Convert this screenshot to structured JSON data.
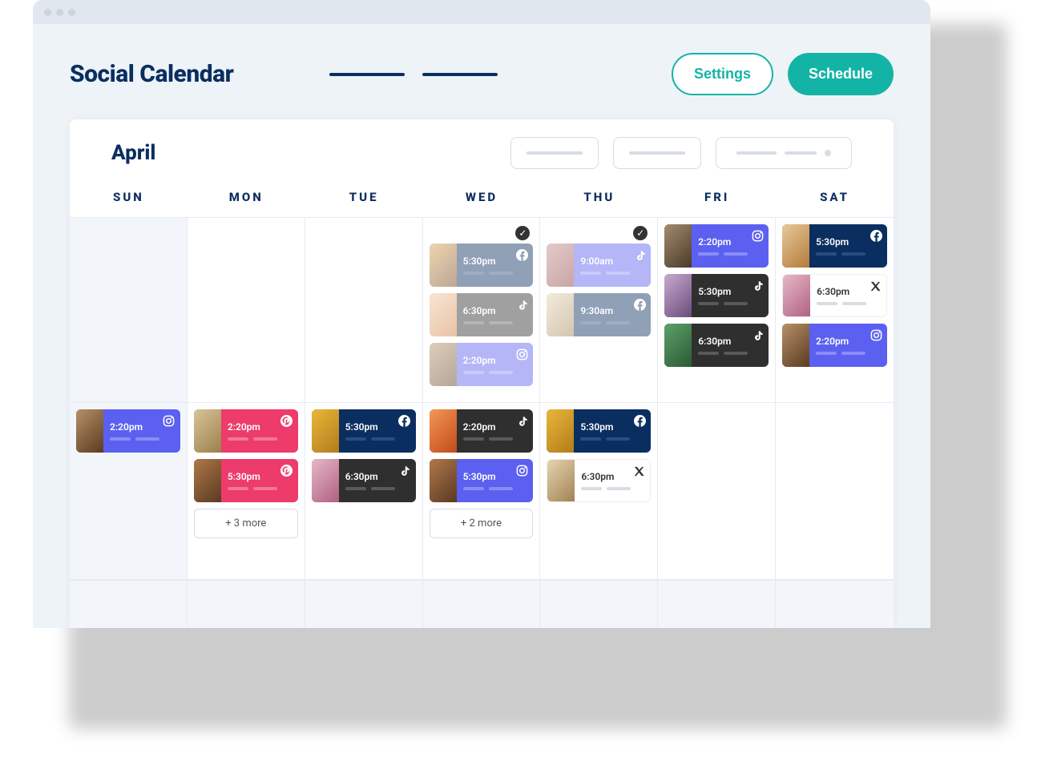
{
  "header": {
    "title": "Social Calendar",
    "settings": "Settings",
    "schedule": "Schedule"
  },
  "month": "April",
  "days": [
    "SUN",
    "MON",
    "TUE",
    "WED",
    "THU",
    "FRI",
    "SAT"
  ],
  "rows": [
    {
      "period": "past",
      "cells": [
        {
          "out": true,
          "posts": []
        },
        {
          "out": false,
          "posts": []
        },
        {
          "out": false,
          "posts": []
        },
        {
          "out": false,
          "checked": true,
          "posts": [
            {
              "time": "5:30pm",
              "color": "c-navy",
              "icon": "facebook",
              "thumb": "t1",
              "faded": true
            },
            {
              "time": "6:30pm",
              "color": "c-dark",
              "icon": "tiktok",
              "thumb": "t5",
              "faded": true
            },
            {
              "time": "2:20pm",
              "color": "c-indigo",
              "icon": "instagram",
              "thumb": "t4",
              "faded": true
            }
          ]
        },
        {
          "out": false,
          "checked": true,
          "posts": [
            {
              "time": "9:00am",
              "color": "c-indigo",
              "icon": "tiktok",
              "thumb": "t2",
              "faded": true
            },
            {
              "time": "9:30am",
              "color": "c-navy",
              "icon": "facebook",
              "thumb": "t14",
              "faded": true
            }
          ]
        },
        {
          "out": false,
          "posts": [
            {
              "time": "2:20pm",
              "color": "c-indigo",
              "icon": "instagram",
              "thumb": "t3"
            },
            {
              "time": "5:30pm",
              "color": "c-dark",
              "icon": "tiktok",
              "thumb": "t7"
            },
            {
              "time": "6:30pm",
              "color": "c-dark",
              "icon": "tiktok",
              "thumb": "t6"
            }
          ]
        },
        {
          "out": false,
          "posts": [
            {
              "time": "5:30pm",
              "color": "c-navy",
              "icon": "facebook",
              "thumb": "t8"
            },
            {
              "time": "6:30pm",
              "color": "c-white",
              "icon": "x",
              "thumb": "t13"
            },
            {
              "time": "2:20pm",
              "color": "c-indigo",
              "icon": "instagram",
              "thumb": "t4"
            }
          ]
        }
      ]
    },
    {
      "period": "current",
      "cells": [
        {
          "out": true,
          "posts": [
            {
              "time": "2:20pm",
              "color": "c-indigo",
              "icon": "instagram",
              "thumb": "t4"
            }
          ]
        },
        {
          "out": false,
          "posts": [
            {
              "time": "2:20pm",
              "color": "c-pink",
              "icon": "pinterest",
              "thumb": "t12"
            },
            {
              "time": "5:30pm",
              "color": "c-pink",
              "icon": "pinterest",
              "thumb": "t11"
            }
          ],
          "more": "+ 3 more"
        },
        {
          "out": false,
          "posts": [
            {
              "time": "5:30pm",
              "color": "c-navy",
              "icon": "facebook",
              "thumb": "t9"
            },
            {
              "time": "6:30pm",
              "color": "c-dark",
              "icon": "tiktok",
              "thumb": "t13"
            }
          ]
        },
        {
          "out": false,
          "posts": [
            {
              "time": "2:20pm",
              "color": "c-dark",
              "icon": "tiktok",
              "thumb": "t10"
            },
            {
              "time": "5:30pm",
              "color": "c-indigo",
              "icon": "instagram",
              "thumb": "t11"
            }
          ],
          "more": "+ 2 more"
        },
        {
          "out": false,
          "posts": [
            {
              "time": "5:30pm",
              "color": "c-navy",
              "icon": "facebook",
              "thumb": "t9"
            },
            {
              "time": "6:30pm",
              "color": "c-white",
              "icon": "x",
              "thumb": "t14"
            }
          ]
        },
        {
          "out": false,
          "posts": []
        },
        {
          "out": false,
          "posts": []
        }
      ]
    },
    {
      "period": "next",
      "cells": [
        {
          "out": true,
          "posts": []
        },
        {
          "out": true,
          "posts": []
        },
        {
          "out": true,
          "posts": []
        },
        {
          "out": true,
          "posts": []
        },
        {
          "out": true,
          "posts": []
        },
        {
          "out": true,
          "posts": []
        },
        {
          "out": true,
          "posts": []
        }
      ]
    }
  ]
}
